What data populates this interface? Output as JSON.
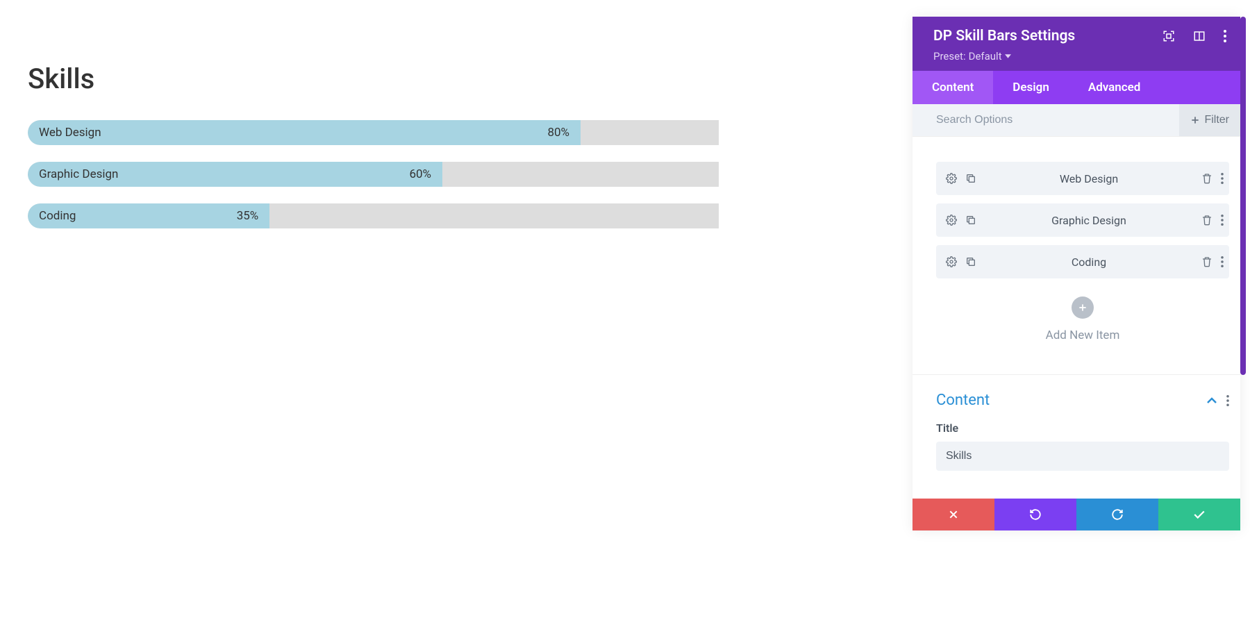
{
  "preview": {
    "title": "Skills",
    "bars": [
      {
        "label": "Web Design",
        "percent": 80,
        "text": "80%"
      },
      {
        "label": "Graphic Design",
        "percent": 60,
        "text": "60%"
      },
      {
        "label": "Coding",
        "percent": 35,
        "text": "35%"
      }
    ]
  },
  "panel": {
    "title": "DP Skill Bars Settings",
    "preset_prefix": "Preset:",
    "preset_name": "Default",
    "tabs": [
      {
        "label": "Content",
        "active": true
      },
      {
        "label": "Design",
        "active": false
      },
      {
        "label": "Advanced",
        "active": false
      }
    ],
    "search_placeholder": "Search Options",
    "filter_label": "Filter",
    "items": [
      {
        "label": "Web Design"
      },
      {
        "label": "Graphic Design"
      },
      {
        "label": "Coding"
      }
    ],
    "add_label": "Add New Item",
    "content_section": {
      "title": "Content",
      "field_label": "Title",
      "field_value": "Skills"
    }
  }
}
